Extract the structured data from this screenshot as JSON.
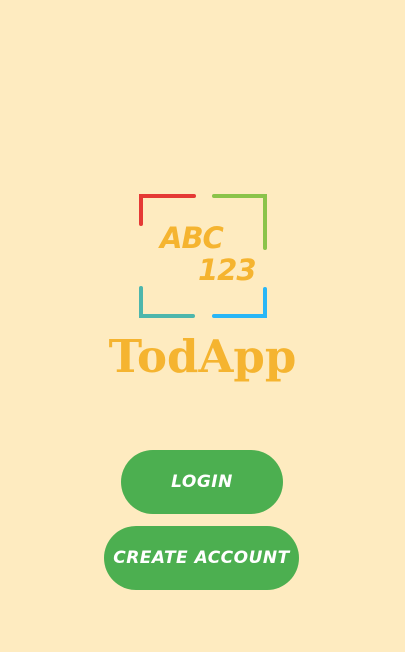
{
  "logo": {
    "line1": "ABC",
    "line2": "123",
    "corner_colors": [
      "#E53935",
      "#8BC34A",
      "#4DB6AC",
      "#29B6F6"
    ]
  },
  "app": {
    "name": "TodApp"
  },
  "actions": {
    "login_label": "LOGIN",
    "create_account_label": "CREATE ACCOUNT"
  },
  "colors": {
    "background": "#FEEBC0",
    "brand": "#F5B430",
    "button": "#4CAF50"
  }
}
